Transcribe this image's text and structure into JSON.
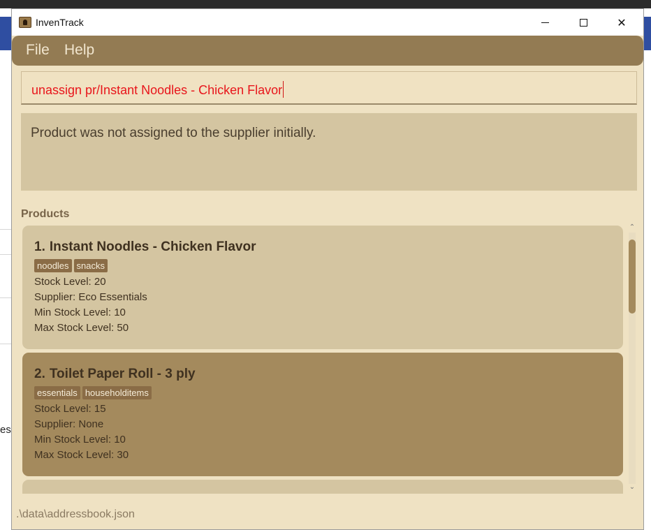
{
  "window": {
    "title": "InvenTrack",
    "minimize_glyph": "—",
    "maximize_glyph": "☐",
    "close_glyph": "✕"
  },
  "menu": {
    "file": "File",
    "help": "Help"
  },
  "command": {
    "value": "unassign pr/Instant Noodles - Chicken Flavor",
    "color": "#e8151b"
  },
  "result": {
    "message": "Product was not assigned to the supplier initially."
  },
  "products": {
    "heading": "Products",
    "items": [
      {
        "index": "1.",
        "name": "Instant Noodles - Chicken Flavor",
        "tags": [
          "noodles",
          "snacks"
        ],
        "stock": "Stock Level: 20",
        "supplier": "Supplier: Eco Essentials",
        "min": "Min Stock Level: 10",
        "max": "Max Stock Level: 50"
      },
      {
        "index": "2.",
        "name": "Toilet Paper Roll - 3 ply",
        "tags": [
          "essentials",
          "householditems"
        ],
        "stock": "Stock Level: 15",
        "supplier": "Supplier: None",
        "min": "Min Stock Level: 10",
        "max": "Max Stock Level: 30"
      }
    ]
  },
  "status": {
    "path": ".\\data\\addressbook.json"
  },
  "background": {
    "fragment": "es/"
  },
  "colors": {
    "menubar": "#937b53",
    "card_light": "#d4c5a1",
    "card_dark": "#a48a5d",
    "window_bg": "#efe2c3"
  }
}
